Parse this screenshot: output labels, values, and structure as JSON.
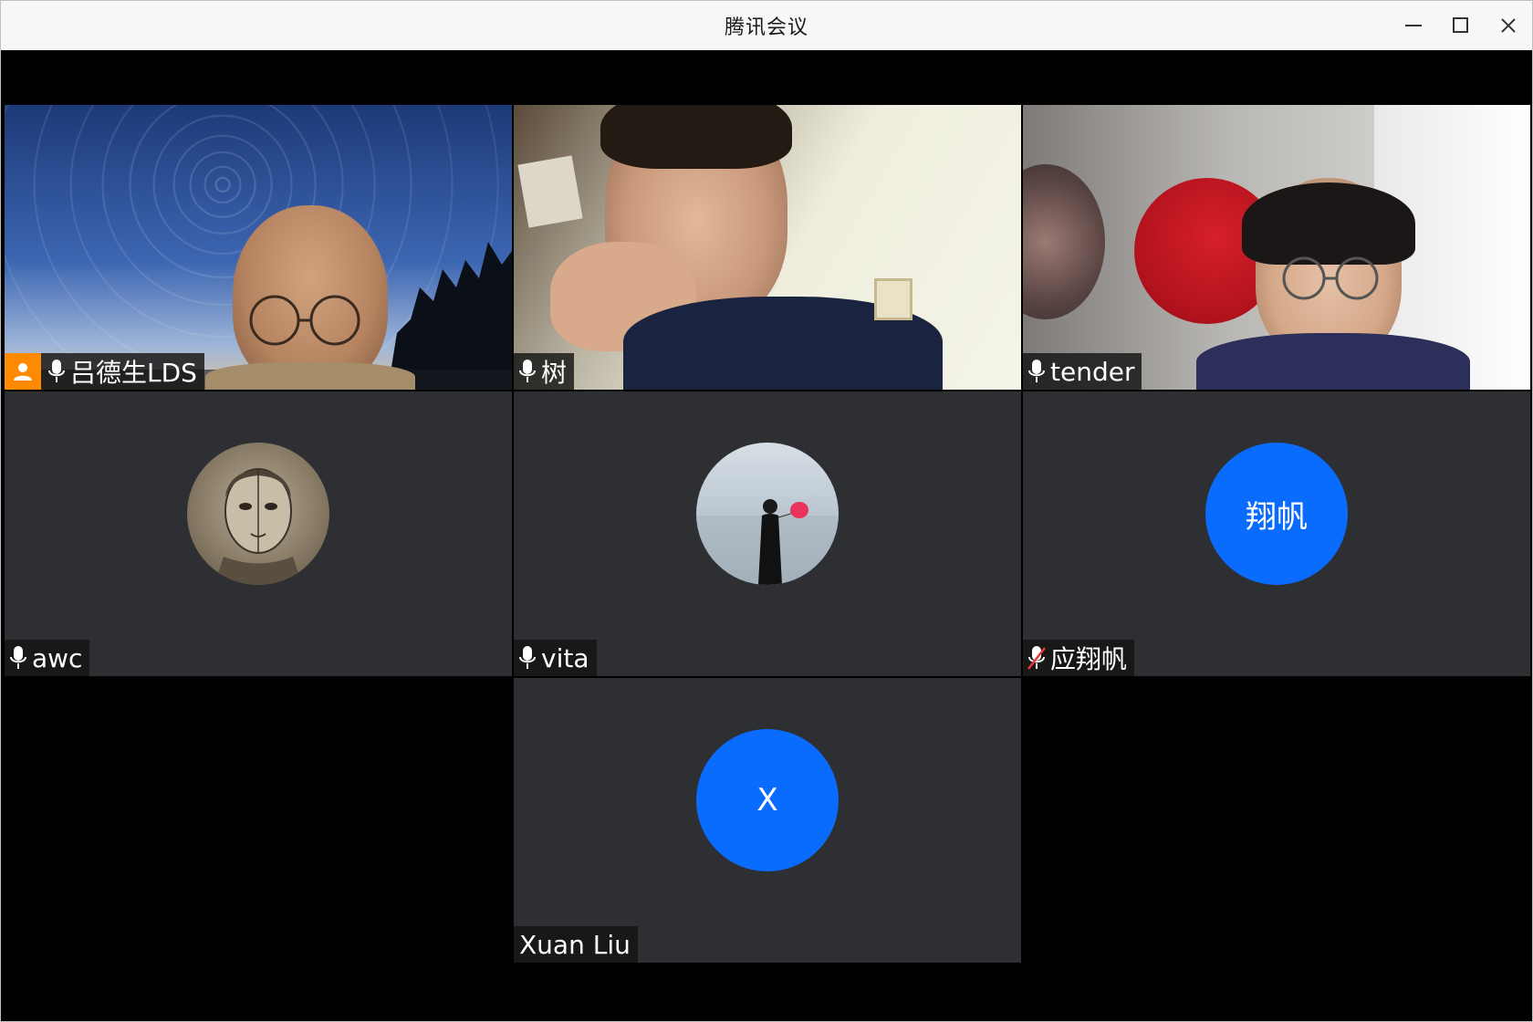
{
  "window": {
    "title": "腾讯会议",
    "controls": [
      "minimize-icon",
      "maximize-icon",
      "close-icon"
    ]
  },
  "participants": [
    {
      "name": "吕德生LDS",
      "is_host": true,
      "mic": "on",
      "mode": "video",
      "scene": "star-trails"
    },
    {
      "name": "树",
      "is_host": false,
      "mic": "on",
      "mode": "video",
      "scene": "room"
    },
    {
      "name": "tender",
      "is_host": false,
      "mic": "on",
      "mode": "video",
      "scene": "wall-art"
    },
    {
      "name": "awc",
      "is_host": false,
      "mic": "on",
      "mode": "avatar-photo"
    },
    {
      "name": "vita",
      "is_host": false,
      "mic": "on",
      "mode": "avatar-photo"
    },
    {
      "name": "应翔帆",
      "is_host": false,
      "mic": "muted",
      "mode": "avatar-initials",
      "initials": "翔帆"
    },
    {
      "name": "Xuan Liu",
      "is_host": false,
      "mic": "none",
      "mode": "avatar-initials",
      "initials": "X"
    }
  ],
  "colors": {
    "tile_bg": "#2d2f33",
    "avatar_blue": "#0a6cff",
    "host_badge": "#ff8a00",
    "active_speaker_border": "#2ec05a",
    "muted_slash": "#e53935"
  }
}
